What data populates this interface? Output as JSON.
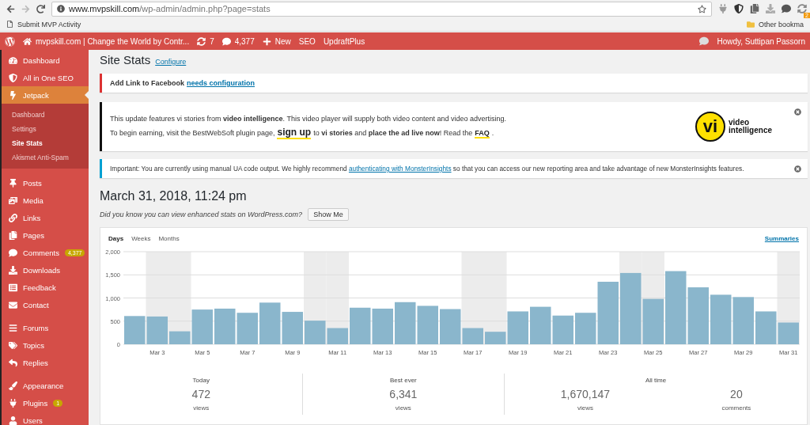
{
  "browser": {
    "url": {
      "domain": "www.mvpskill.com",
      "path": "/wp-admin/admin.php?page=stats"
    },
    "bookmarks": [
      {
        "label": "Submit MVP Activity"
      }
    ],
    "other_bookmarks": "Other bookma",
    "extension_badge": "2"
  },
  "admin_bar": {
    "site": "mvpskill.com | Change the World by Contr...",
    "updates": "7",
    "comments": "4,377",
    "new": "New",
    "items": [
      "SEO",
      "UpdraftPlus"
    ],
    "greeting": "Howdy, Suttipan Passorn"
  },
  "sidebar": {
    "groups": [
      [
        {
          "label": "Dashboard",
          "selected": false
        },
        {
          "label": "All in One SEO",
          "selected": false
        },
        {
          "label": "Jetpack",
          "selected": true,
          "children": [
            {
              "label": "Dashboard",
              "selected": false
            },
            {
              "label": "Settings",
              "selected": false
            },
            {
              "label": "Site Stats",
              "selected": true
            },
            {
              "label": "Akismet Anti-Spam",
              "selected": false
            }
          ]
        }
      ],
      [
        {
          "label": "Posts",
          "selected": false
        },
        {
          "label": "Media",
          "selected": false
        },
        {
          "label": "Links",
          "selected": false
        },
        {
          "label": "Pages",
          "selected": false
        },
        {
          "label": "Comments",
          "selected": false,
          "badge": "4,377"
        },
        {
          "label": "Downloads",
          "selected": false
        },
        {
          "label": "Feedback",
          "selected": false
        },
        {
          "label": "Contact",
          "selected": false
        }
      ],
      [
        {
          "label": "Forums",
          "selected": false
        },
        {
          "label": "Topics",
          "selected": false
        },
        {
          "label": "Replies",
          "selected": false
        }
      ],
      [
        {
          "label": "Appearance",
          "selected": false
        },
        {
          "label": "Plugins",
          "selected": false,
          "badge": "1"
        },
        {
          "label": "Users",
          "selected": false
        }
      ]
    ]
  },
  "page": {
    "title": "Site Stats",
    "title_link": "Configure"
  },
  "notices": [
    {
      "kind": "error",
      "title": "Add Link to Facebook",
      "link": "needs configuration"
    },
    {
      "kind": "promo",
      "dismissible": true,
      "lines": [
        [
          {
            "kind": "text",
            "text": "This update features vi stories from **video intelligence**. This video player will supply both video content and video advertising."
          }
        ],
        [
          {
            "kind": "text",
            "text": "To begin earning, visit the BestWebSoft plugin page,"
          },
          {
            "kind": "link",
            "text": "sign up"
          },
          {
            "kind": "text",
            "text": "to **vi stories** and **place the ad live now**! Read the"
          },
          {
            "kind": "link",
            "text": "FAQ"
          },
          {
            "kind": "text",
            "text": "."
          }
        ]
      ],
      "logo_mark": "vi",
      "logo_text": "video intelligence"
    },
    {
      "kind": "info",
      "dismissible": true,
      "before": "Important: You are currently using manual UA code output. We highly recommend",
      "link": "authenticating with MonsterInsights",
      "after": "so that you can access our new reporting area and take advantage of new MonsterInsights features."
    }
  ],
  "stats": {
    "date": "March 31, 2018, 11:24 pm",
    "hint": "Did you know you can view enhanced stats on WordPress.com?",
    "hint_button": "Show Me",
    "tabs": [
      {
        "label": "Days",
        "selected": true
      },
      {
        "label": "Weeks",
        "selected": false
      },
      {
        "label": "Months",
        "selected": false
      }
    ],
    "summaries_link": "Summaries",
    "chart_data": {
      "type": "bar",
      "grid": true,
      "categories": [
        null,
        "Mar 3",
        null,
        "Mar 5",
        null,
        "Mar 7",
        null,
        "Mar 9",
        null,
        "Mar 11",
        null,
        "Mar 13",
        null,
        "Mar 15",
        null,
        "Mar 17",
        null,
        "Mar 19",
        null,
        "Mar 21",
        null,
        "Mar 23",
        null,
        "Mar 25",
        null,
        "Mar 27",
        null,
        "Mar 29",
        null,
        "Mar 31"
      ],
      "series": [
        {
          "color": "#8ab6cc",
          "values": [
            610,
            600,
            280,
            750,
            770,
            680,
            900,
            700,
            510,
            350,
            790,
            770,
            910,
            830,
            760,
            350,
            270,
            710,
            810,
            620,
            680,
            1350,
            1540,
            980,
            1580,
            1230,
            1070,
            1020,
            710,
            470
          ]
        }
      ],
      "ylim": [
        0,
        2000
      ],
      "yticks": [
        {
          "value": 0,
          "label": "0"
        },
        {
          "value": 500,
          "label": "500"
        },
        {
          "value": 1000,
          "label": "1,000"
        },
        {
          "value": 1500,
          "label": "1,500"
        },
        {
          "value": 2000,
          "label": "2,000"
        }
      ]
    },
    "summary": [
      {
        "title": "Today",
        "values": [
          {
            "number": "472",
            "unit": "views"
          }
        ]
      },
      {
        "title": "Best ever",
        "values": [
          {
            "number": "6,341",
            "unit": "views"
          }
        ]
      },
      {
        "title": "All time",
        "values": [
          {
            "number": "1,670,147",
            "unit": "views"
          },
          {
            "number": "20",
            "unit": "comments"
          }
        ]
      }
    ]
  }
}
